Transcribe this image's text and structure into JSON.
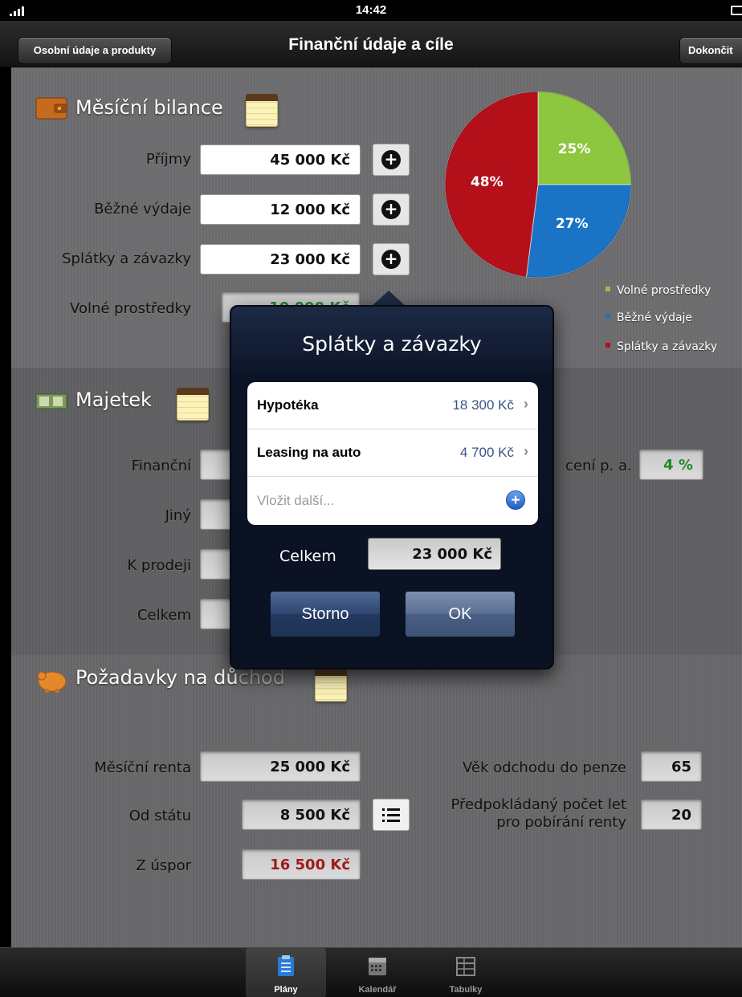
{
  "status_bar": {
    "time": "14:42"
  },
  "nav": {
    "back_label": "Osobní údaje a produkty",
    "title": "Finanční údaje a cíle",
    "done_label": "Dokončit"
  },
  "bilance": {
    "title": "Měsíční bilance",
    "rows": [
      {
        "label": "Příjmy",
        "value": "45 000 Kč"
      },
      {
        "label": "Běžné výdaje",
        "value": "12 000 Kč"
      },
      {
        "label": "Splátky a závazky",
        "value": "23 000 Kč"
      },
      {
        "label": "Volné prostředky",
        "value": "10 000 Kč"
      }
    ]
  },
  "chart_data": {
    "type": "pie",
    "slices": [
      {
        "name": "Volné prostředky",
        "value": 25,
        "label": "25%",
        "color": "#8dc63f"
      },
      {
        "name": "Běžné výdaje",
        "value": 27,
        "label": "27%",
        "color": "#1a73c4"
      },
      {
        "name": "Splátky a závazky",
        "value": 48,
        "label": "48%",
        "color": "#b3101a"
      }
    ],
    "legend": [
      "Volné prostředky",
      "Běžné výdaje",
      "Splátky a závazky"
    ],
    "legend_placement": "bottom-right"
  },
  "majetek": {
    "title": "Majetek",
    "rows": [
      {
        "label": "Finanční"
      },
      {
        "label": "Jiný"
      },
      {
        "label": "K prodeji"
      },
      {
        "label": "Celkem"
      }
    ],
    "rate_label_partial": "cení p. a.",
    "rate_value": "4 %"
  },
  "duchod": {
    "title_main": "Požadavky na dů",
    "title_faded": "chod",
    "monthly_label": "Měsíční renta",
    "monthly_value": "25 000 Kč",
    "state_label": "Od státu",
    "state_value": "8 500 Kč",
    "savings_label": "Z úspor",
    "savings_value": "16 500 Kč",
    "retire_age_label": "Věk odchodu do penze",
    "retire_age_value": "65",
    "years_label_1": "Předpokládaný počet let",
    "years_label_2": "pro pobírání renty",
    "years_value": "20"
  },
  "popover": {
    "title": "Splátky a závazky",
    "items": [
      {
        "name": "Hypotéka",
        "value": "18 300 Kč"
      },
      {
        "name": "Leasing na auto",
        "value": "4 700 Kč"
      }
    ],
    "add_placeholder": "Vložit další...",
    "total_label": "Celkem",
    "total_value": "23 000 Kč",
    "cancel_label": "Storno",
    "ok_label": "OK"
  },
  "tabs": [
    {
      "label": "Plány",
      "icon": "clipboard-icon",
      "active": true
    },
    {
      "label": "Kalendář",
      "icon": "calendar-icon",
      "active": false
    },
    {
      "label": "Tabulky",
      "icon": "table-icon",
      "active": false
    }
  ]
}
